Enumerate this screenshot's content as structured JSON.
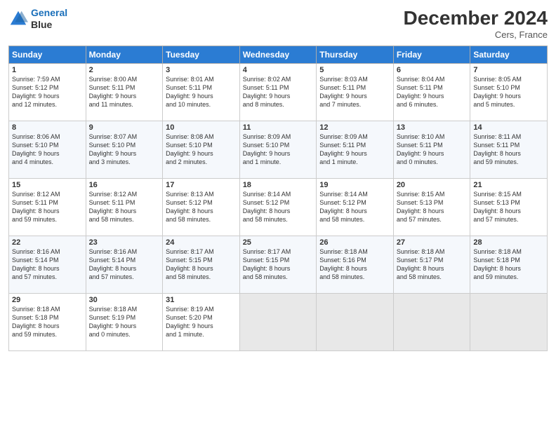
{
  "header": {
    "logo_line1": "General",
    "logo_line2": "Blue",
    "month_title": "December 2024",
    "location": "Cers, France"
  },
  "weekdays": [
    "Sunday",
    "Monday",
    "Tuesday",
    "Wednesday",
    "Thursday",
    "Friday",
    "Saturday"
  ],
  "weeks": [
    [
      {
        "day": "1",
        "info": "Sunrise: 7:59 AM\nSunset: 5:12 PM\nDaylight: 9 hours\nand 12 minutes."
      },
      {
        "day": "2",
        "info": "Sunrise: 8:00 AM\nSunset: 5:11 PM\nDaylight: 9 hours\nand 11 minutes."
      },
      {
        "day": "3",
        "info": "Sunrise: 8:01 AM\nSunset: 5:11 PM\nDaylight: 9 hours\nand 10 minutes."
      },
      {
        "day": "4",
        "info": "Sunrise: 8:02 AM\nSunset: 5:11 PM\nDaylight: 9 hours\nand 8 minutes."
      },
      {
        "day": "5",
        "info": "Sunrise: 8:03 AM\nSunset: 5:11 PM\nDaylight: 9 hours\nand 7 minutes."
      },
      {
        "day": "6",
        "info": "Sunrise: 8:04 AM\nSunset: 5:11 PM\nDaylight: 9 hours\nand 6 minutes."
      },
      {
        "day": "7",
        "info": "Sunrise: 8:05 AM\nSunset: 5:10 PM\nDaylight: 9 hours\nand 5 minutes."
      }
    ],
    [
      {
        "day": "8",
        "info": "Sunrise: 8:06 AM\nSunset: 5:10 PM\nDaylight: 9 hours\nand 4 minutes."
      },
      {
        "day": "9",
        "info": "Sunrise: 8:07 AM\nSunset: 5:10 PM\nDaylight: 9 hours\nand 3 minutes."
      },
      {
        "day": "10",
        "info": "Sunrise: 8:08 AM\nSunset: 5:10 PM\nDaylight: 9 hours\nand 2 minutes."
      },
      {
        "day": "11",
        "info": "Sunrise: 8:09 AM\nSunset: 5:10 PM\nDaylight: 9 hours\nand 1 minute."
      },
      {
        "day": "12",
        "info": "Sunrise: 8:09 AM\nSunset: 5:11 PM\nDaylight: 9 hours\nand 1 minute."
      },
      {
        "day": "13",
        "info": "Sunrise: 8:10 AM\nSunset: 5:11 PM\nDaylight: 9 hours\nand 0 minutes."
      },
      {
        "day": "14",
        "info": "Sunrise: 8:11 AM\nSunset: 5:11 PM\nDaylight: 8 hours\nand 59 minutes."
      }
    ],
    [
      {
        "day": "15",
        "info": "Sunrise: 8:12 AM\nSunset: 5:11 PM\nDaylight: 8 hours\nand 59 minutes."
      },
      {
        "day": "16",
        "info": "Sunrise: 8:12 AM\nSunset: 5:11 PM\nDaylight: 8 hours\nand 58 minutes."
      },
      {
        "day": "17",
        "info": "Sunrise: 8:13 AM\nSunset: 5:12 PM\nDaylight: 8 hours\nand 58 minutes."
      },
      {
        "day": "18",
        "info": "Sunrise: 8:14 AM\nSunset: 5:12 PM\nDaylight: 8 hours\nand 58 minutes."
      },
      {
        "day": "19",
        "info": "Sunrise: 8:14 AM\nSunset: 5:12 PM\nDaylight: 8 hours\nand 58 minutes."
      },
      {
        "day": "20",
        "info": "Sunrise: 8:15 AM\nSunset: 5:13 PM\nDaylight: 8 hours\nand 57 minutes."
      },
      {
        "day": "21",
        "info": "Sunrise: 8:15 AM\nSunset: 5:13 PM\nDaylight: 8 hours\nand 57 minutes."
      }
    ],
    [
      {
        "day": "22",
        "info": "Sunrise: 8:16 AM\nSunset: 5:14 PM\nDaylight: 8 hours\nand 57 minutes."
      },
      {
        "day": "23",
        "info": "Sunrise: 8:16 AM\nSunset: 5:14 PM\nDaylight: 8 hours\nand 57 minutes."
      },
      {
        "day": "24",
        "info": "Sunrise: 8:17 AM\nSunset: 5:15 PM\nDaylight: 8 hours\nand 58 minutes."
      },
      {
        "day": "25",
        "info": "Sunrise: 8:17 AM\nSunset: 5:15 PM\nDaylight: 8 hours\nand 58 minutes."
      },
      {
        "day": "26",
        "info": "Sunrise: 8:18 AM\nSunset: 5:16 PM\nDaylight: 8 hours\nand 58 minutes."
      },
      {
        "day": "27",
        "info": "Sunrise: 8:18 AM\nSunset: 5:17 PM\nDaylight: 8 hours\nand 58 minutes."
      },
      {
        "day": "28",
        "info": "Sunrise: 8:18 AM\nSunset: 5:18 PM\nDaylight: 8 hours\nand 59 minutes."
      }
    ],
    [
      {
        "day": "29",
        "info": "Sunrise: 8:18 AM\nSunset: 5:18 PM\nDaylight: 8 hours\nand 59 minutes."
      },
      {
        "day": "30",
        "info": "Sunrise: 8:18 AM\nSunset: 5:19 PM\nDaylight: 9 hours\nand 0 minutes."
      },
      {
        "day": "31",
        "info": "Sunrise: 8:19 AM\nSunset: 5:20 PM\nDaylight: 9 hours\nand 1 minute."
      },
      {
        "day": "",
        "info": ""
      },
      {
        "day": "",
        "info": ""
      },
      {
        "day": "",
        "info": ""
      },
      {
        "day": "",
        "info": ""
      }
    ]
  ]
}
